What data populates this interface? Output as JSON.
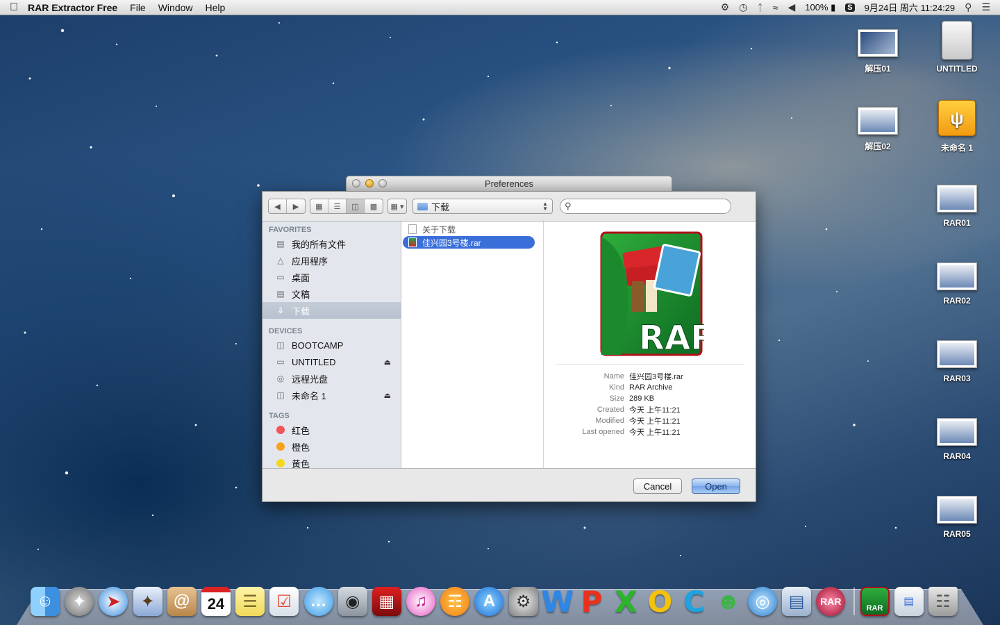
{
  "menubar": {
    "app_name": "RAR Extractor Free",
    "menus": [
      "File",
      "Window",
      "Help"
    ],
    "battery": "100%",
    "datetime": "9月24日 周六  11:24:29"
  },
  "desktop_icons": [
    {
      "label": "解压01",
      "kind": "thumb"
    },
    {
      "label": "UNTITLED",
      "kind": "drive"
    },
    {
      "label": "解压02",
      "kind": "thumb"
    },
    {
      "label": "未命名 1",
      "kind": "usb"
    },
    {
      "label": "RAR01",
      "kind": "thumb"
    },
    {
      "label": "RAR02",
      "kind": "thumb"
    },
    {
      "label": "RAR03",
      "kind": "thumb"
    },
    {
      "label": "RAR04",
      "kind": "thumb"
    },
    {
      "label": "RAR05",
      "kind": "thumb"
    }
  ],
  "window": {
    "title": "Preferences",
    "path": "下载",
    "search_placeholder": ""
  },
  "sidebar": {
    "favorites_header": "FAVORITES",
    "favorites": [
      {
        "label": "我的所有文件",
        "icon": "all-files-icon"
      },
      {
        "label": "应用程序",
        "icon": "applications-icon"
      },
      {
        "label": "桌面",
        "icon": "desktop-icon"
      },
      {
        "label": "文稿",
        "icon": "documents-icon"
      },
      {
        "label": "下载",
        "icon": "downloads-icon",
        "selected": true
      }
    ],
    "devices_header": "DEVICES",
    "devices": [
      {
        "label": "BOOTCAMP",
        "icon": "disk-icon",
        "eject": false
      },
      {
        "label": "UNTITLED",
        "icon": "disk-icon",
        "eject": true
      },
      {
        "label": "远程光盘",
        "icon": "optical-disc-icon",
        "eject": false
      },
      {
        "label": "未命名 1",
        "icon": "disk-icon",
        "eject": true
      }
    ],
    "tags_header": "TAGS",
    "tags": [
      {
        "label": "红色",
        "color": "#f0555a"
      },
      {
        "label": "橙色",
        "color": "#f7a21c"
      },
      {
        "label": "黄色",
        "color": "#f5d81c"
      }
    ]
  },
  "files": [
    {
      "name": "关于下载",
      "selected": false
    },
    {
      "name": "佳兴园3号楼.rar",
      "selected": true
    }
  ],
  "preview": {
    "logo_text": "RAR",
    "fields": [
      {
        "key": "Name",
        "value": "佳兴园3号楼.rar"
      },
      {
        "key": "Kind",
        "value": "RAR Archive"
      },
      {
        "key": "Size",
        "value": "289 KB"
      },
      {
        "key": "Created",
        "value": "今天 上午11:21"
      },
      {
        "key": "Modified",
        "value": "今天 上午11:21"
      },
      {
        "key": "Last opened",
        "value": "今天 上午11:21"
      }
    ]
  },
  "buttons": {
    "cancel": "Cancel",
    "open": "Open"
  },
  "dock": {
    "calendar_day": "24",
    "word_letter": "W",
    "ppt_letter": "P",
    "excel_letter": "X",
    "o_letter": "O",
    "c_letter": "C",
    "rar_label": "RAR"
  }
}
